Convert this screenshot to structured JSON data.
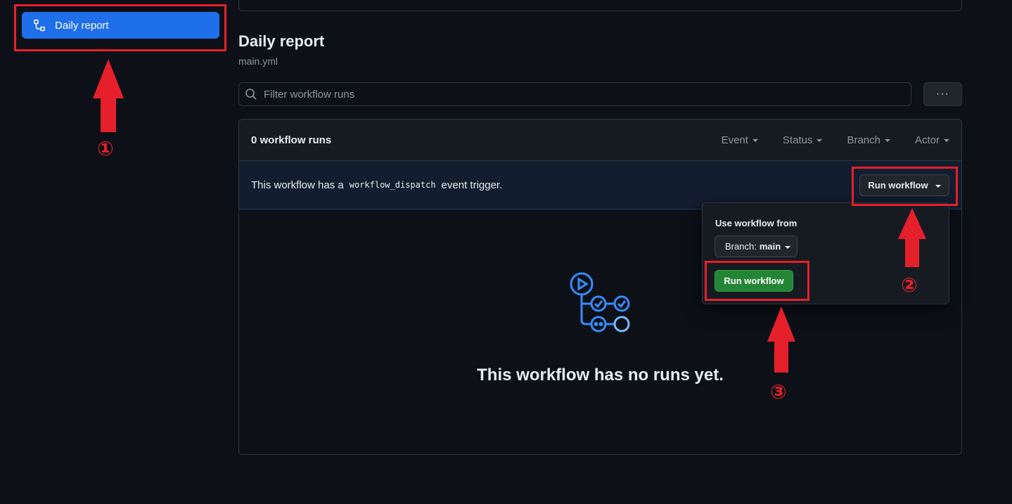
{
  "sidebar": {
    "active_item": {
      "label": "Daily report",
      "icon": "workflow-icon"
    }
  },
  "workflow": {
    "title": "Daily report",
    "file": "main.yml"
  },
  "search": {
    "placeholder": "Filter workflow runs",
    "icon": "search-icon"
  },
  "more_menu": {
    "label": "···",
    "icon": "kebab-horizontal-icon"
  },
  "runs": {
    "count_label": "0 workflow runs",
    "filters": [
      "Event",
      "Status",
      "Branch",
      "Actor"
    ],
    "dispatch_prefix": "This workflow has a",
    "dispatch_code": "workflow_dispatch",
    "dispatch_suffix": "event trigger.",
    "run_button_label": "Run workflow",
    "empty_state": "This workflow has no runs yet.",
    "empty_icon": "workflow-graph-icon"
  },
  "dropdown": {
    "label": "Use workflow from",
    "branch_prefix": "Branch:",
    "branch_value": "main",
    "submit_label": "Run workflow"
  },
  "annotations": {
    "step1": "①",
    "step2": "②",
    "step3": "③",
    "color": "#e5202b"
  },
  "colors": {
    "accent": "#1f6feb",
    "green": "#238636",
    "background": "#0d1117"
  }
}
